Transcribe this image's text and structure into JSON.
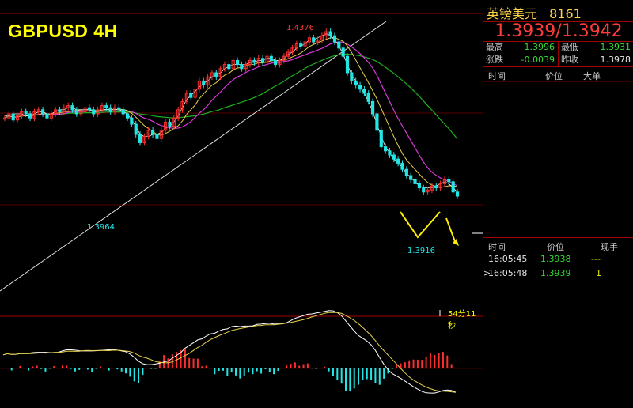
{
  "chart_title": "GBPUSD 4H",
  "countdown": "54分11秒",
  "quote": {
    "name": "英镑美元",
    "code": "8161",
    "bid_ask": "1.3939/1.3942",
    "stats": [
      {
        "label": "最高",
        "value": "1.3996",
        "color": "#33dd33"
      },
      {
        "label": "最低",
        "value": "1.3931",
        "color": "#33dd33"
      },
      {
        "label": "涨跌",
        "value": "-0.0039",
        "color": "#33dd33"
      },
      {
        "label": "昨收",
        "value": "1.3978",
        "color": "#e6e6e6"
      }
    ],
    "order_headers": [
      "时间",
      "价位",
      "大单"
    ],
    "tick_headers": [
      "时间",
      "价位",
      "现手"
    ],
    "ticks": [
      {
        "marker": "",
        "time": "16:05:45",
        "price": "1.3938",
        "vol": "---"
      },
      {
        "marker": ">",
        "time": "16:05:48",
        "price": "1.3939",
        "vol": "1"
      }
    ]
  },
  "colors": {
    "up": "#ff2e2e",
    "down": "#22e6e6",
    "ma_fast": "#ffffff",
    "ma_mid": "#e6d24a",
    "ma_slow": "#d838d8",
    "ma_long": "#20b020",
    "trend": "#e0e0e0",
    "arrow": "#ffee00",
    "border": "#a00000"
  },
  "chart_data": {
    "type": "candlestick",
    "annotations": [
      {
        "text": "1.4376",
        "kind": "high"
      },
      {
        "text": "1.3964",
        "kind": "low"
      },
      {
        "text": "1.3916",
        "kind": "low"
      }
    ],
    "candles_close": [
      0.58,
      0.6,
      0.57,
      0.59,
      0.61,
      0.6,
      0.58,
      0.61,
      0.62,
      0.6,
      0.58,
      0.6,
      0.62,
      0.61,
      0.63,
      0.64,
      0.62,
      0.6,
      0.61,
      0.63,
      0.62,
      0.6,
      0.62,
      0.64,
      0.63,
      0.61,
      0.63,
      0.62,
      0.6,
      0.58,
      0.55,
      0.5,
      0.46,
      0.49,
      0.52,
      0.5,
      0.48,
      0.52,
      0.56,
      0.54,
      0.58,
      0.62,
      0.66,
      0.7,
      0.68,
      0.72,
      0.76,
      0.74,
      0.78,
      0.8,
      0.78,
      0.82,
      0.84,
      0.82,
      0.86,
      0.84,
      0.82,
      0.84,
      0.86,
      0.85,
      0.87,
      0.85,
      0.88,
      0.86,
      0.84,
      0.86,
      0.88,
      0.9,
      0.92,
      0.94,
      0.93,
      0.95,
      0.97,
      0.95,
      0.96,
      0.98,
      1.0,
      0.98,
      0.95,
      0.92,
      0.88,
      0.8,
      0.76,
      0.74,
      0.72,
      0.7,
      0.66,
      0.6,
      0.52,
      0.44,
      0.42,
      0.4,
      0.38,
      0.36,
      0.33,
      0.3,
      0.28,
      0.26,
      0.24,
      0.22,
      0.23,
      0.25,
      0.24,
      0.26,
      0.28,
      0.27,
      0.22,
      0.2
    ],
    "ma_fast": [
      0.59,
      0.59,
      0.6,
      0.6,
      0.6,
      0.59,
      0.59,
      0.6,
      0.61,
      0.61,
      0.6,
      0.6,
      0.61,
      0.62,
      0.62,
      0.63,
      0.63,
      0.62,
      0.62,
      0.62,
      0.62,
      0.61,
      0.61,
      0.62,
      0.62,
      0.62,
      0.62,
      0.62,
      0.61,
      0.6,
      0.57,
      0.54,
      0.5,
      0.49,
      0.49,
      0.5,
      0.5,
      0.51,
      0.53,
      0.54,
      0.56,
      0.59,
      0.63,
      0.67,
      0.69,
      0.71,
      0.73,
      0.75,
      0.76,
      0.78,
      0.79,
      0.8,
      0.82,
      0.83,
      0.84,
      0.84,
      0.84,
      0.84,
      0.85,
      0.85,
      0.86,
      0.86,
      0.87,
      0.87,
      0.86,
      0.86,
      0.87,
      0.89,
      0.9,
      0.92,
      0.93,
      0.94,
      0.96,
      0.96,
      0.97,
      0.98,
      0.99,
      0.98,
      0.96,
      0.93,
      0.89,
      0.84,
      0.79,
      0.76,
      0.73,
      0.7,
      0.66,
      0.61,
      0.55,
      0.49,
      0.44,
      0.41,
      0.38,
      0.36,
      0.34,
      0.31,
      0.29,
      0.27,
      0.25,
      0.24,
      0.24,
      0.24,
      0.25,
      0.26,
      0.27,
      0.26,
      0.24,
      0.22
    ]
  }
}
